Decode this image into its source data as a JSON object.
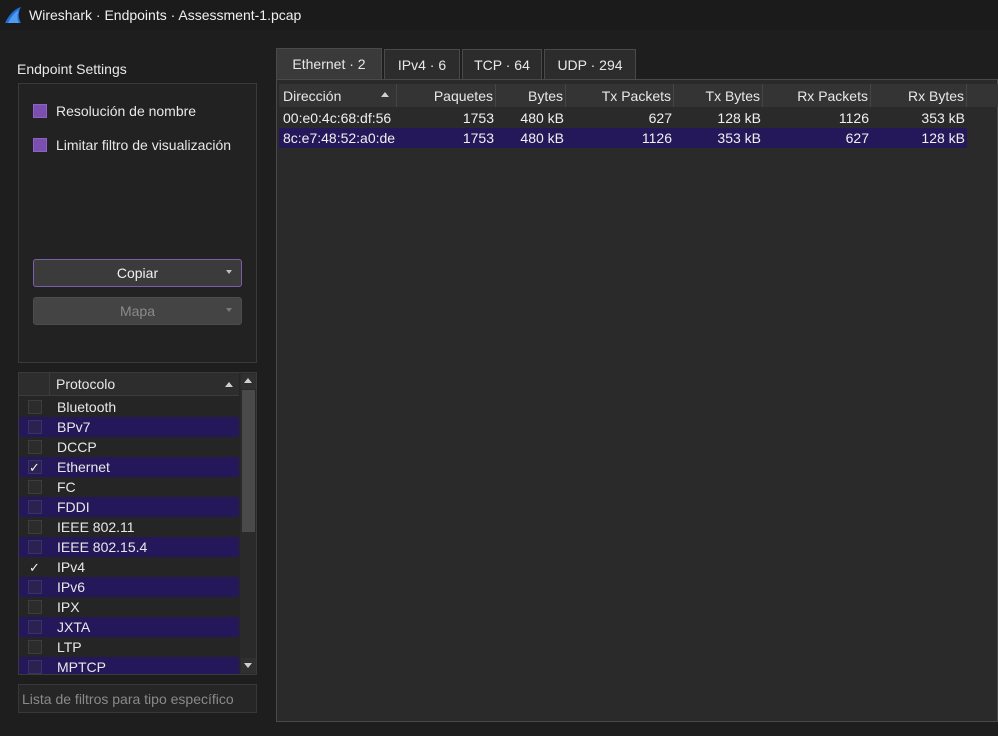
{
  "window": {
    "title": "Wireshark · Endpoints · Assessment-1.pcap",
    "logo_icon": "wireshark-fin-icon",
    "logo_color": "#1f6fd6"
  },
  "settings": {
    "heading": "Endpoint Settings",
    "name_resolution_label": "Resolución de nombre",
    "limit_filter_label": "Limitar filtro de visualización",
    "copy_button": "Copiar",
    "map_button": "Mapa"
  },
  "protocols": {
    "header": "Protocolo",
    "items": [
      {
        "name": "Bluetooth",
        "checked": false
      },
      {
        "name": "BPv7",
        "checked": false
      },
      {
        "name": "DCCP",
        "checked": false
      },
      {
        "name": "Ethernet",
        "checked": true
      },
      {
        "name": "FC",
        "checked": false
      },
      {
        "name": "FDDI",
        "checked": false
      },
      {
        "name": "IEEE 802.11",
        "checked": false
      },
      {
        "name": "IEEE 802.15.4",
        "checked": false
      },
      {
        "name": "IPv4",
        "checked": true
      },
      {
        "name": "IPv6",
        "checked": false
      },
      {
        "name": "IPX",
        "checked": false
      },
      {
        "name": "JXTA",
        "checked": false
      },
      {
        "name": "LTP",
        "checked": false
      },
      {
        "name": "MPTCP",
        "checked": false
      }
    ],
    "check_glyph": "✓"
  },
  "filter": {
    "placeholder": "Lista de filtros para tipo específico"
  },
  "tabs": [
    {
      "label": "Ethernet · 2",
      "active": true
    },
    {
      "label": "IPv4 · 6",
      "active": false
    },
    {
      "label": "TCP · 64",
      "active": false
    },
    {
      "label": "UDP · 294",
      "active": false
    }
  ],
  "table": {
    "columns": [
      "Dirección",
      "Paquetes",
      "Bytes",
      "Tx Packets",
      "Tx Bytes",
      "Rx Packets",
      "Rx Bytes"
    ],
    "rows": [
      [
        "00:e0:4c:68:df:56",
        "1753",
        "480 kB",
        "627",
        "128 kB",
        "1126",
        "353 kB"
      ],
      [
        "8c:e7:48:52:a0:de",
        "1753",
        "480 kB",
        "1126",
        "353 kB",
        "627",
        "128 kB"
      ]
    ]
  },
  "colors": {
    "accent_purple": "#7a4fb0",
    "row_highlight": "#24185a",
    "background": "#1e1e1e"
  }
}
